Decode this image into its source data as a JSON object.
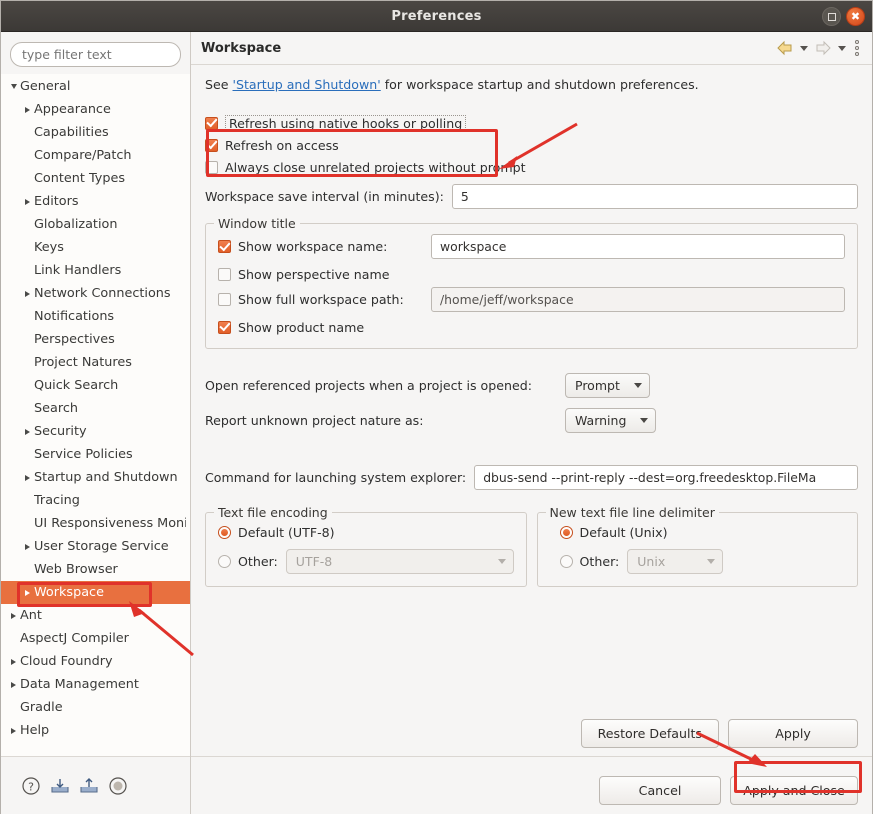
{
  "window": {
    "title": "Preferences",
    "maximize_icon": "maximize-icon",
    "close_icon": "close-icon"
  },
  "sidebar": {
    "filter_placeholder": "type filter text",
    "filter_value": "",
    "items": [
      {
        "label": "General",
        "indent": 0,
        "twisty": "down",
        "selected": false
      },
      {
        "label": "Appearance",
        "indent": 1,
        "twisty": "right",
        "selected": false
      },
      {
        "label": "Capabilities",
        "indent": 1,
        "twisty": "none",
        "selected": false
      },
      {
        "label": "Compare/Patch",
        "indent": 1,
        "twisty": "none",
        "selected": false
      },
      {
        "label": "Content Types",
        "indent": 1,
        "twisty": "none",
        "selected": false
      },
      {
        "label": "Editors",
        "indent": 1,
        "twisty": "right",
        "selected": false
      },
      {
        "label": "Globalization",
        "indent": 1,
        "twisty": "none",
        "selected": false
      },
      {
        "label": "Keys",
        "indent": 1,
        "twisty": "none",
        "selected": false
      },
      {
        "label": "Link Handlers",
        "indent": 1,
        "twisty": "none",
        "selected": false
      },
      {
        "label": "Network Connections",
        "indent": 1,
        "twisty": "right",
        "selected": false
      },
      {
        "label": "Notifications",
        "indent": 1,
        "twisty": "none",
        "selected": false
      },
      {
        "label": "Perspectives",
        "indent": 1,
        "twisty": "none",
        "selected": false
      },
      {
        "label": "Project Natures",
        "indent": 1,
        "twisty": "none",
        "selected": false
      },
      {
        "label": "Quick Search",
        "indent": 1,
        "twisty": "none",
        "selected": false
      },
      {
        "label": "Search",
        "indent": 1,
        "twisty": "none",
        "selected": false
      },
      {
        "label": "Security",
        "indent": 1,
        "twisty": "right",
        "selected": false
      },
      {
        "label": "Service Policies",
        "indent": 1,
        "twisty": "none",
        "selected": false
      },
      {
        "label": "Startup and Shutdown",
        "indent": 1,
        "twisty": "right",
        "selected": false
      },
      {
        "label": "Tracing",
        "indent": 1,
        "twisty": "none",
        "selected": false
      },
      {
        "label": "UI Responsiveness Monitoring",
        "indent": 1,
        "twisty": "none",
        "selected": false
      },
      {
        "label": "User Storage Service",
        "indent": 1,
        "twisty": "right",
        "selected": false
      },
      {
        "label": "Web Browser",
        "indent": 1,
        "twisty": "none",
        "selected": false
      },
      {
        "label": "Workspace",
        "indent": 1,
        "twisty": "right",
        "selected": true
      },
      {
        "label": "Ant",
        "indent": 0,
        "twisty": "right",
        "selected": false
      },
      {
        "label": "AspectJ Compiler",
        "indent": 0,
        "twisty": "none",
        "selected": false
      },
      {
        "label": "Cloud Foundry",
        "indent": 0,
        "twisty": "right",
        "selected": false
      },
      {
        "label": "Data Management",
        "indent": 0,
        "twisty": "right",
        "selected": false
      },
      {
        "label": "Gradle",
        "indent": 0,
        "twisty": "none",
        "selected": false
      },
      {
        "label": "Help",
        "indent": 0,
        "twisty": "right",
        "selected": false
      }
    ],
    "bottom_icons": [
      "help-icon",
      "import-icon",
      "export-icon",
      "target-icon"
    ]
  },
  "page": {
    "title": "Workspace",
    "header_icons": [
      "back-arrow-icon",
      "back-dropdown-caret-icon",
      "forward-arrow-icon",
      "forward-dropdown-caret-icon",
      "view-menu-icon"
    ],
    "intro_prefix": "See ",
    "intro_link": "'Startup and Shutdown'",
    "intro_suffix": " for workspace startup and shutdown preferences.",
    "checkboxes": [
      {
        "label": "Refresh using native hooks or polling",
        "checked": true,
        "mnemonic": "R",
        "focused": true
      },
      {
        "label": "Refresh on access",
        "checked": true,
        "mnemonic": "s",
        "focused": false
      },
      {
        "label": "Always close unrelated projects without prompt",
        "checked": false,
        "mnemonic": "c",
        "focused": false
      }
    ],
    "save_interval": {
      "label": "Workspace save interval (in minutes):",
      "value": "5"
    },
    "window_title_group": {
      "legend": "Window title",
      "show_workspace_name": {
        "label": "Show workspace name:",
        "checked": true,
        "value": "workspace"
      },
      "show_perspective_name": {
        "label": "Show perspective name",
        "checked": false
      },
      "show_full_path": {
        "label": "Show full workspace path:",
        "checked": false,
        "value": "/home/jeff/workspace"
      },
      "show_product_name": {
        "label": "Show product name",
        "checked": true
      }
    },
    "open_referenced": {
      "label": "Open referenced projects when a project is opened:",
      "value": "Prompt"
    },
    "report_nature": {
      "label": "Report unknown project nature as:",
      "value": "Warning"
    },
    "system_explorer": {
      "label": "Command for launching system explorer:",
      "value": "dbus-send --print-reply --dest=org.freedesktop.FileMa"
    },
    "encoding_group": {
      "legend": "Text file encoding",
      "default_label": "Default (UTF-8)",
      "default_selected": true,
      "other_label": "Other:",
      "other_selected": false,
      "other_value": "UTF-8"
    },
    "delimiter_group": {
      "legend": "New text file line delimiter",
      "default_label": "Default (Unix)",
      "default_selected": true,
      "other_label": "Other:",
      "other_selected": false,
      "other_value": "Unix"
    }
  },
  "buttons": {
    "restore_defaults": "Restore Defaults",
    "apply": "Apply",
    "cancel": "Cancel",
    "apply_and_close": "Apply and Close"
  },
  "annotations": {
    "color": "#e0322a",
    "highlighted": [
      "refresh-checkbox-group",
      "workspace-tree-item",
      "apply-and-close-button"
    ]
  }
}
